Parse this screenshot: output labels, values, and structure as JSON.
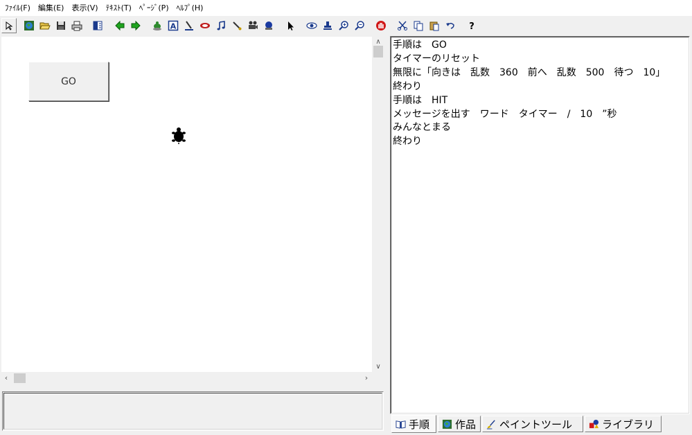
{
  "menu": [
    "ﾌｧｲﾙ(F)",
    "編集(E)",
    "表示(V)",
    "ﾃｷｽﾄ(T)",
    "ﾍﾟｰｼﾞ(P)",
    "ﾍﾙﾌﾟ(H)"
  ],
  "canvas": {
    "go_button_label": "GO"
  },
  "editor": {
    "lines": [
      "手順は　GO",
      "タイマーのリセット",
      "無限に「向きは　乱数　360　前へ　乱数　500　待つ　10」",
      "終わり",
      "手順は　HIT",
      "メッセージを出す　ワード　タイマー　/　10　”秒",
      "みんなとまる",
      "終わり"
    ]
  },
  "tabs": [
    {
      "label": "手順",
      "icon": "book-icon",
      "active": true
    },
    {
      "label": "作品",
      "icon": "globe-icon",
      "active": false
    },
    {
      "label": "ペイントツール",
      "icon": "brush-icon",
      "active": false
    },
    {
      "label": "ライブラリ",
      "icon": "shapes-icon",
      "active": false
    }
  ],
  "toolbar_icons": [
    "pointer-small-icon",
    "globe-icon",
    "open-folder-icon",
    "save-icon",
    "print-icon",
    "panel-icon",
    "back-arrow-icon",
    "forward-arrow-icon",
    "turtle-hatch-icon",
    "text-box-icon",
    "pen-icon",
    "eraser-icon",
    "music-note-icon",
    "paint-icon",
    "camera-icon",
    "stamp-icon",
    "cursor-icon",
    "eye-icon",
    "stamp-tool-icon",
    "zoom-in-icon",
    "zoom-out-icon",
    "stop-hand-icon",
    "cut-icon",
    "copy-icon",
    "paste-icon",
    "undo-icon",
    "help-icon"
  ]
}
